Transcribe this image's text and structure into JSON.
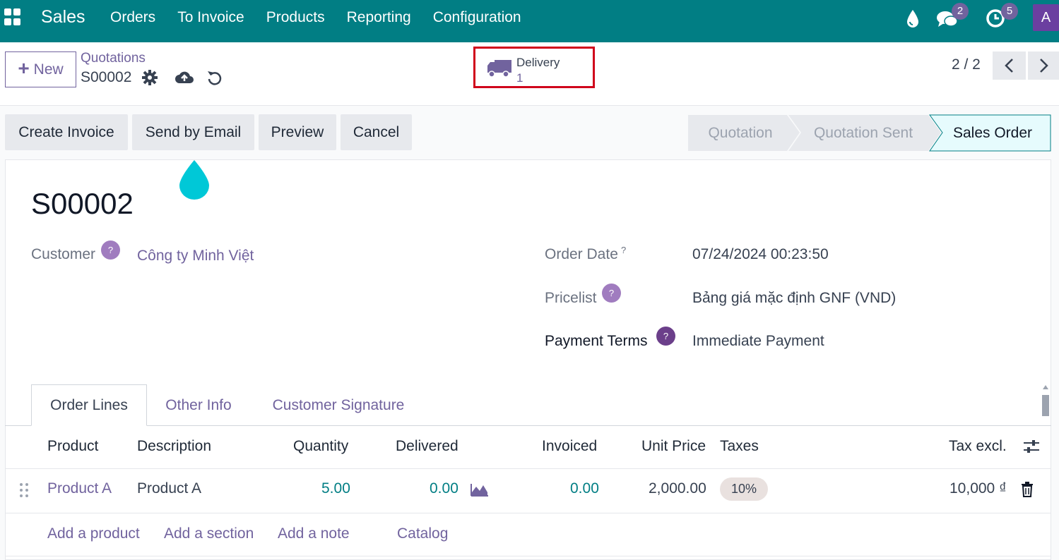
{
  "navbar": {
    "brand": "Sales",
    "menu": [
      "Orders",
      "To Invoice",
      "Products",
      "Reporting",
      "Configuration"
    ],
    "messages_count": "2",
    "activities_count": "5",
    "avatar_letter": "A"
  },
  "control": {
    "new_label": "New",
    "breadcrumb": "Quotations",
    "record": "S00002",
    "delivery_label": "Delivery",
    "delivery_count": "1",
    "pager": "2 / 2"
  },
  "actions": [
    "Create Invoice",
    "Send by Email",
    "Preview",
    "Cancel"
  ],
  "stages": {
    "items": [
      "Quotation",
      "Quotation Sent",
      "Sales Order"
    ],
    "active": "Sales Order"
  },
  "form": {
    "title": "S00002",
    "customer_label": "Customer",
    "customer_value": "Công ty Minh Việt",
    "order_date_label": "Order Date",
    "order_date_value": "07/24/2024 00:23:50",
    "pricelist_label": "Pricelist",
    "pricelist_value": "Bảng giá mặc định GNF (VND)",
    "payment_terms_label": "Payment Terms",
    "payment_terms_value": "Immediate Payment",
    "help_mark": "?"
  },
  "tabs": [
    "Order Lines",
    "Other Info",
    "Customer Signature"
  ],
  "table": {
    "headers": [
      "Product",
      "Description",
      "Quantity",
      "Delivered",
      "Invoiced",
      "Unit Price",
      "Taxes",
      "Tax excl."
    ],
    "rows": [
      {
        "product": "Product A",
        "description": "Product A",
        "quantity": "5.00",
        "delivered": "0.00",
        "invoiced": "0.00",
        "unit_price": "2,000.00",
        "taxes": "10%",
        "tax_excl": "10,000 ₫"
      }
    ],
    "add_links": [
      "Add a product",
      "Add a section",
      "Add a note",
      "Catalog"
    ]
  },
  "colors": {
    "navbar": "#017e84",
    "accent": "#71639e",
    "active_stage": "#e6fbfd",
    "highlight_box": "#d0021b"
  }
}
